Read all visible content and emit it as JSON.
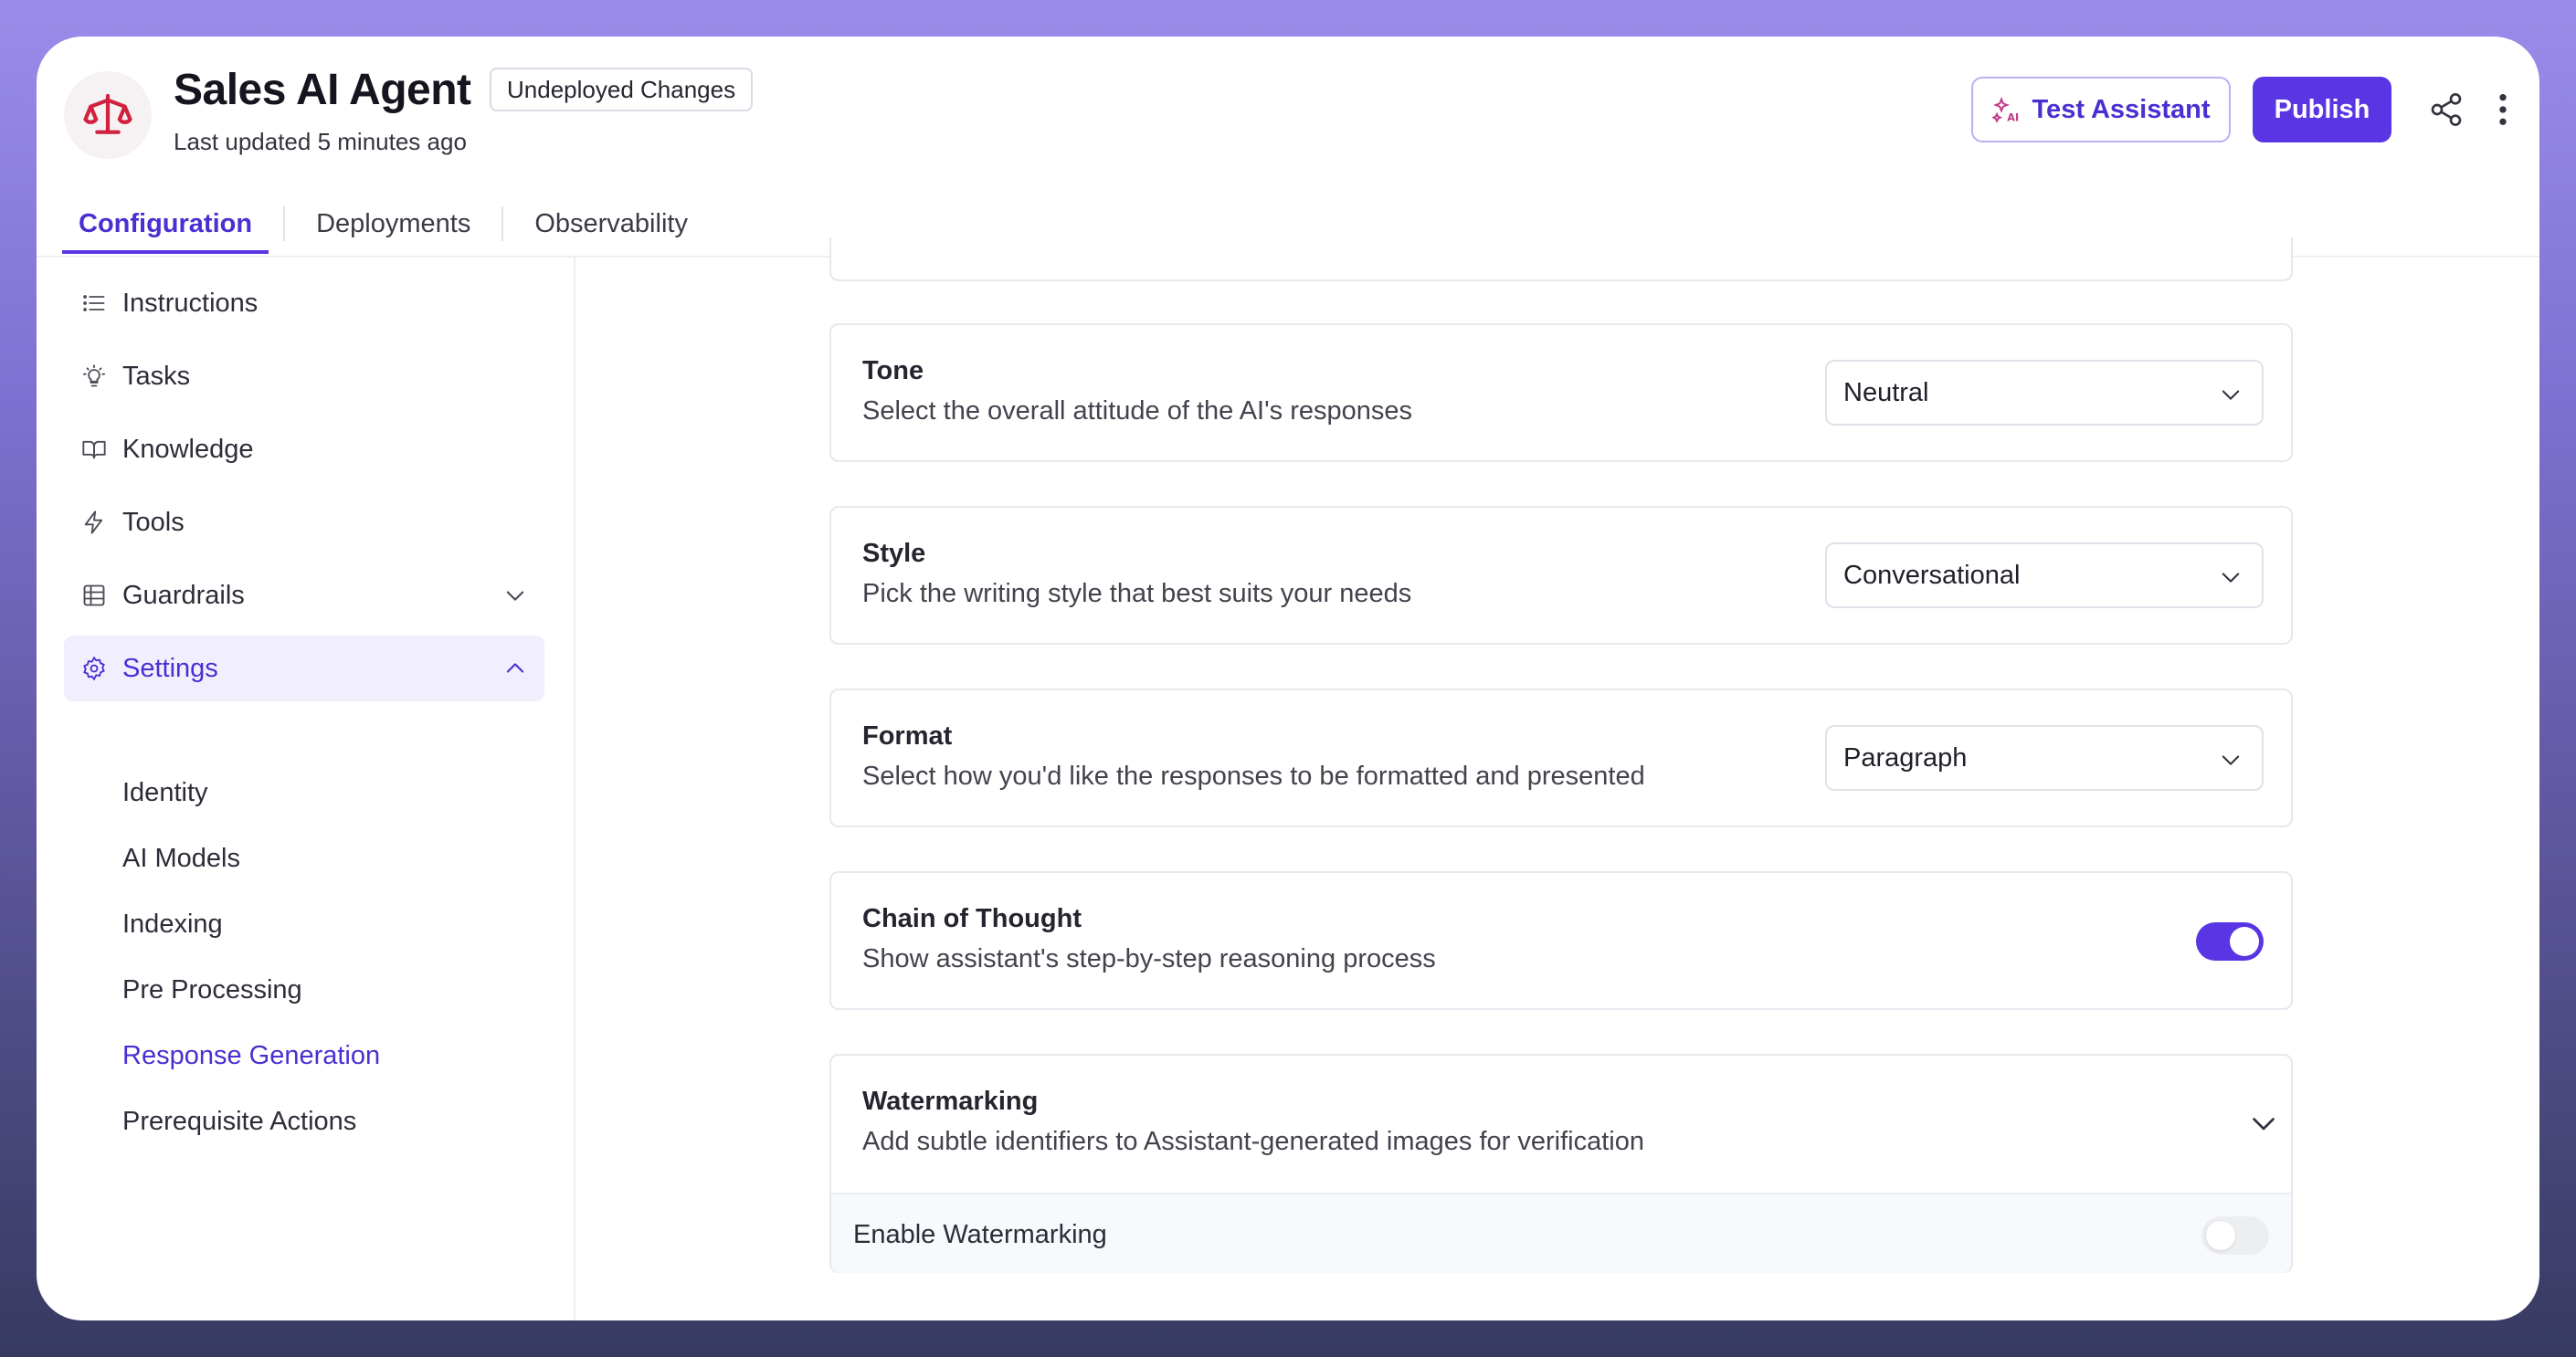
{
  "header": {
    "title": "Sales AI Agent",
    "badge": "Undeployed Changes",
    "subtitle": "Last updated 5 minutes ago",
    "test_button": "Test Assistant",
    "publish_button": "Publish",
    "logo_icon": "scales-icon",
    "accent_color": "#5a35e3"
  },
  "tabs": [
    {
      "label": "Configuration",
      "active": true
    },
    {
      "label": "Deployments",
      "active": false
    },
    {
      "label": "Observability",
      "active": false
    }
  ],
  "sidebar": {
    "items": [
      {
        "label": "Instructions",
        "icon": "list-icon"
      },
      {
        "label": "Tasks",
        "icon": "lightbulb-icon"
      },
      {
        "label": "Knowledge",
        "icon": "book-icon"
      },
      {
        "label": "Tools",
        "icon": "bolt-icon"
      },
      {
        "label": "Guardrails",
        "icon": "table-icon"
      },
      {
        "label": "Settings",
        "icon": "gear-icon"
      }
    ],
    "settings_sub": [
      {
        "label": "Identity"
      },
      {
        "label": "AI Models"
      },
      {
        "label": "Indexing"
      },
      {
        "label": "Pre Processing"
      },
      {
        "label": "Response Generation",
        "active": true
      },
      {
        "label": "Prerequisite Actions"
      }
    ]
  },
  "main": {
    "tone": {
      "title": "Tone",
      "desc": "Select the overall attitude of the AI's responses",
      "value": "Neutral"
    },
    "style": {
      "title": "Style",
      "desc": "Pick the writing style that best suits your needs",
      "value": "Conversational"
    },
    "format": {
      "title": "Format",
      "desc": "Select how you'd like the responses to be formatted and presented",
      "value": "Paragraph"
    },
    "cot": {
      "title": "Chain of Thought",
      "desc": "Show assistant's step-by-step reasoning process",
      "enabled": true
    },
    "watermarking": {
      "title": "Watermarking",
      "desc": "Add subtle identifiers to Assistant-generated images for verification",
      "enable_label": "Enable Watermarking",
      "enabled": false
    }
  }
}
